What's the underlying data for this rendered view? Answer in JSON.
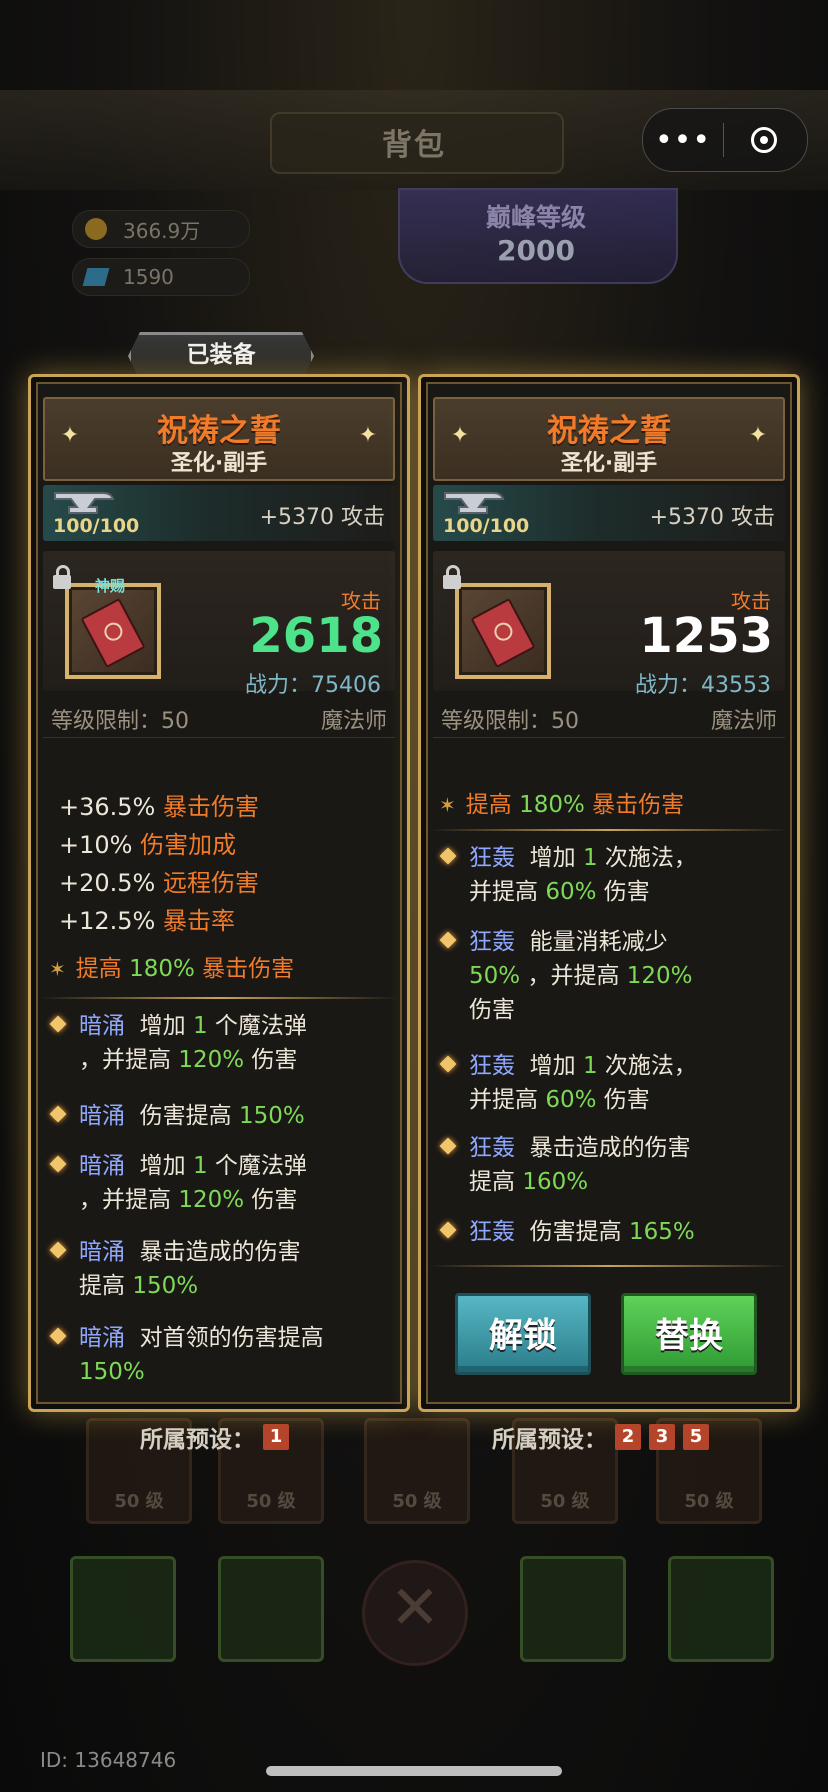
{
  "header": {
    "title": "背包"
  },
  "capsule": {
    "more": "•••"
  },
  "currency": [
    {
      "icon": "gold-coin-icon",
      "value": "366.9万"
    },
    {
      "icon": "gem-icon",
      "value": "1590"
    }
  ],
  "peak": {
    "title": "巅峰等级",
    "value": "2000"
  },
  "bg_slot_level": "50 级",
  "equipped_tab": "已装备",
  "cards": [
    {
      "name": "祝祷之誓",
      "subtitle": "圣化·副手",
      "anvil_count": "100/100",
      "atk_bonus": "+5370 攻击",
      "divine_tag": "神赐",
      "atk_label": "攻击",
      "atk_value": "2618",
      "power": "战力：75406",
      "req": "等级限制：50",
      "class": "魔法师",
      "affixes": [
        {
          "val": "+36.5%",
          "name": "暴击伤害"
        },
        {
          "val": "+10%",
          "name": "伤害加成"
        },
        {
          "val": "+20.5%",
          "name": "远程伤害"
        },
        {
          "val": "+12.5%",
          "name": "暴击率"
        }
      ],
      "special": {
        "prefix": "提高",
        "val": "180%",
        "name": "暴击伤害"
      },
      "skills": [
        {
          "tag": "暗涌",
          "t1": "增加",
          "n1": "1",
          "t2": "个魔法弹",
          "l2a": "，并提高",
          "n2": "120%",
          "l2b": "伤害"
        },
        {
          "tag": "暗涌",
          "t1": "伤害提高",
          "n1": "150%"
        },
        {
          "tag": "暗涌",
          "t1": "增加",
          "n1": "1",
          "t2": "个魔法弹",
          "l2a": "，并提高",
          "n2": "120%",
          "l2b": "伤害"
        },
        {
          "tag": "暗涌",
          "t1": "暴击造成的伤害",
          "l2a": "提高",
          "n2": "150%"
        },
        {
          "tag": "暗涌",
          "t1": "对首领的伤害提高",
          "n2": "150%"
        }
      ],
      "preset_label": "所属预设：",
      "presets": [
        "1"
      ]
    },
    {
      "name": "祝祷之誓",
      "subtitle": "圣化·副手",
      "anvil_count": "100/100",
      "atk_bonus": "+5370 攻击",
      "atk_label": "攻击",
      "atk_value": "1253",
      "power": "战力：43553",
      "req": "等级限制：50",
      "class": "魔法师",
      "special": {
        "prefix": "提高",
        "val": "180%",
        "name": "暴击伤害"
      },
      "skills": [
        {
          "tag": "狂轰",
          "t1": "增加",
          "n1": "1",
          "t2": "次施法，",
          "l2a": "并提高",
          "n2": "60%",
          "l2b": "伤害"
        },
        {
          "tag": "狂轰",
          "t1": "能量消耗减少",
          "n2": "50%",
          "l2a": "，并提高",
          "n3": "120%",
          "l3": "伤害"
        },
        {
          "tag": "狂轰",
          "t1": "增加",
          "n1": "1",
          "t2": "次施法，",
          "l2a": "并提高",
          "n2": "60%",
          "l2b": "伤害"
        },
        {
          "tag": "狂轰",
          "t1": "暴击造成的伤害",
          "l2a": "提高",
          "n2": "160%"
        },
        {
          "tag": "狂轰",
          "t1": "伤害提高",
          "n1": "165%"
        }
      ],
      "buttons": {
        "unlock": "解锁",
        "replace": "替换"
      },
      "preset_label": "所属预设：",
      "presets": [
        "2",
        "3",
        "5"
      ]
    }
  ],
  "footer": {
    "id": "ID: 13648746"
  }
}
